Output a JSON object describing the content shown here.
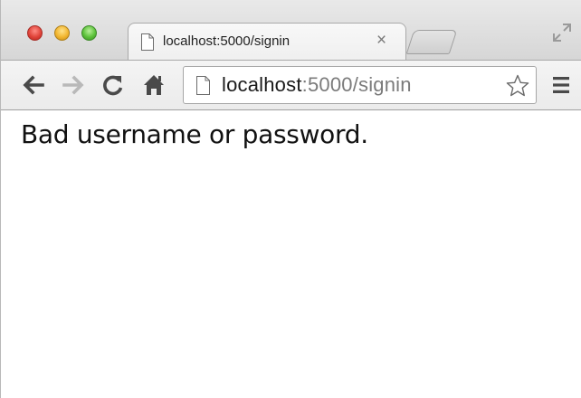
{
  "window": {
    "controls": [
      "close",
      "minimize",
      "zoom"
    ]
  },
  "tab": {
    "title": "localhost:5000/signin",
    "close_glyph": "×",
    "favicon": "page-icon"
  },
  "toolbar": {
    "back_icon": "arrow-left-icon",
    "forward_icon": "arrow-right-icon",
    "reload_icon": "reload-icon",
    "home_icon": "home-icon",
    "menu_icon": "hamburger-icon"
  },
  "omnibox": {
    "host": "localhost",
    "path": ":5000/signin",
    "bookmark_icon": "star-icon"
  },
  "page": {
    "message": "Bad username or password."
  },
  "colors": {
    "close": "#e0443a",
    "minimize": "#f2b630",
    "zoom": "#5cc23a",
    "url_host": "#1a1a1a",
    "url_path": "#7b7b7b"
  }
}
